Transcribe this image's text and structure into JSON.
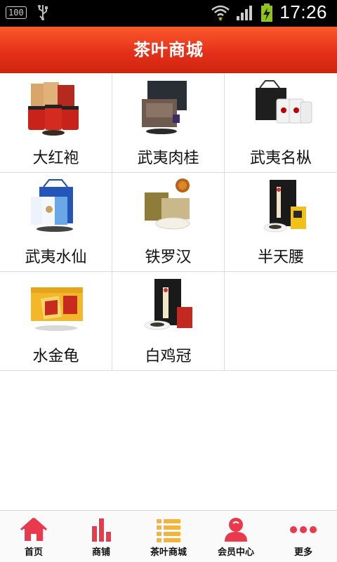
{
  "status_bar": {
    "battery_box": "100",
    "time": "17:26"
  },
  "header": {
    "title": "茶叶商城"
  },
  "products": [
    {
      "name": "大红袍"
    },
    {
      "name": "武夷肉桂"
    },
    {
      "name": "武夷名枞"
    },
    {
      "name": "武夷水仙"
    },
    {
      "name": "铁罗汉"
    },
    {
      "name": "半天腰"
    },
    {
      "name": "水金龟"
    },
    {
      "name": "白鸡冠"
    }
  ],
  "bottom_nav": {
    "items": [
      {
        "label": "首页",
        "icon": "home-icon"
      },
      {
        "label": "商铺",
        "icon": "bar-chart-icon"
      },
      {
        "label": "茶叶商城",
        "icon": "list-icon"
      },
      {
        "label": "会员中心",
        "icon": "user-icon"
      },
      {
        "label": "更多",
        "icon": "more-dots-icon"
      }
    ]
  },
  "colors": {
    "accent": "#e6311a",
    "nav_icon": "#e83a4c"
  }
}
